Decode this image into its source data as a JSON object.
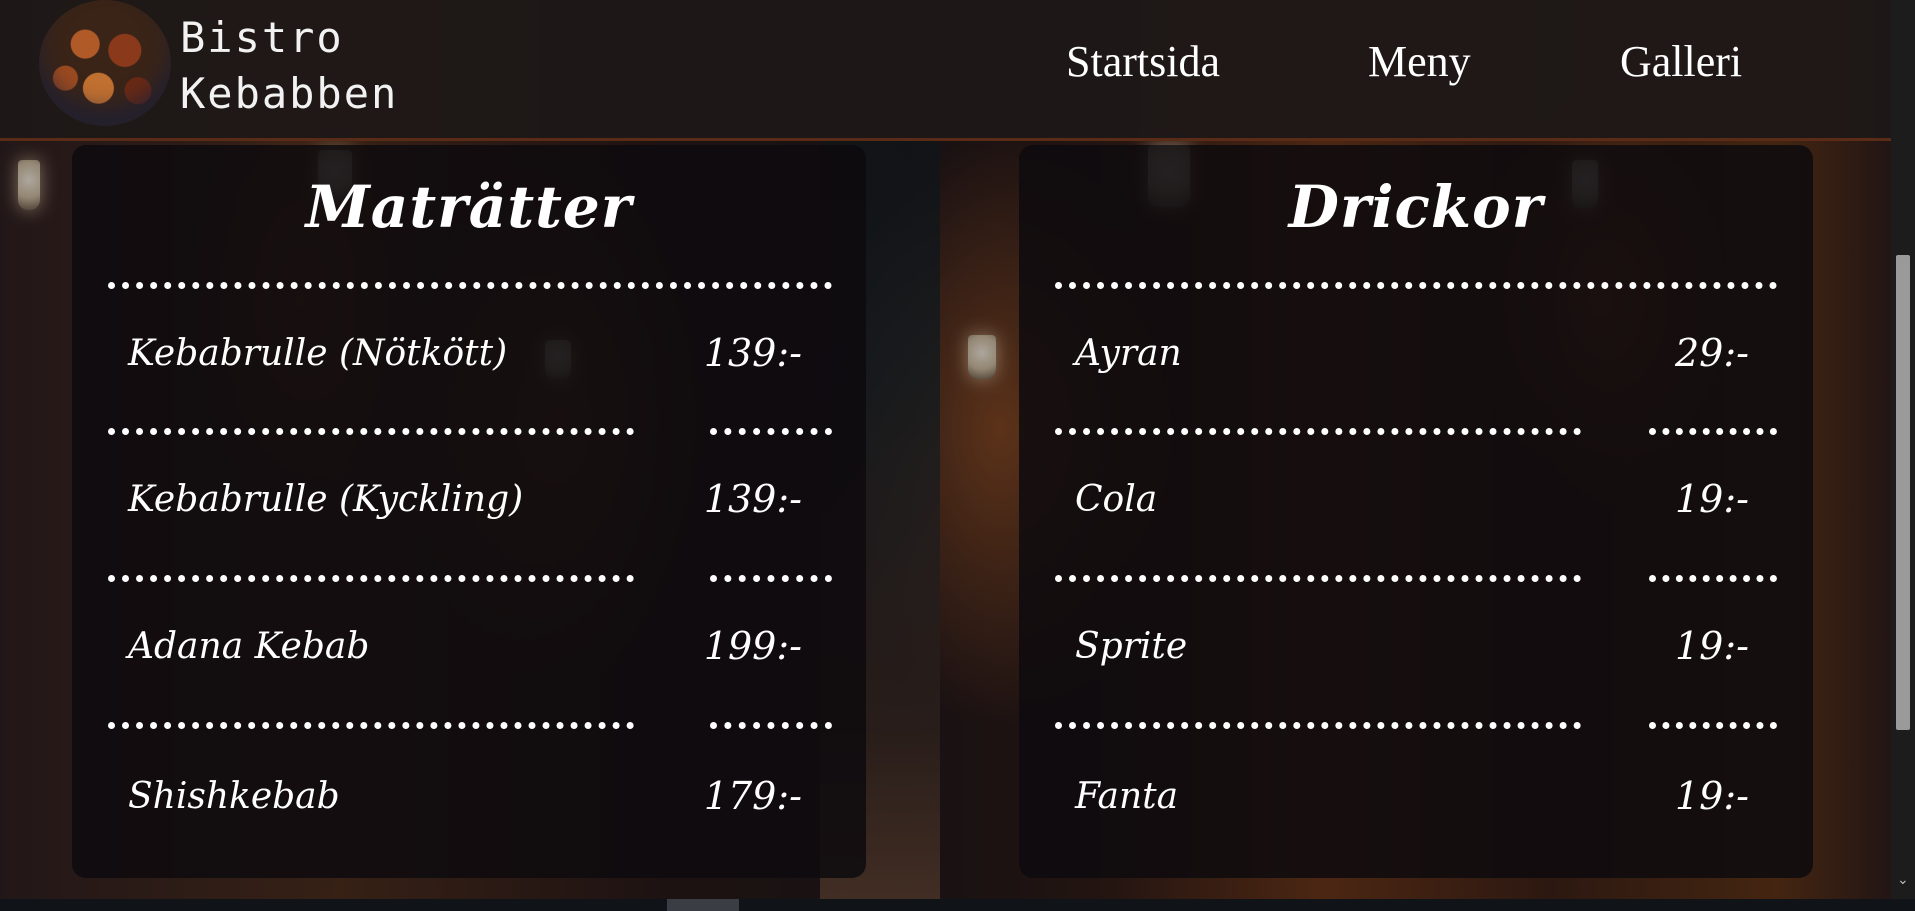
{
  "site": {
    "logo_line1": "Bistro",
    "logo_line2": "Kebabben"
  },
  "nav": {
    "items": [
      "Startsida",
      "Meny",
      "Galleri"
    ]
  },
  "food": {
    "title": "Maträtter",
    "items": [
      {
        "name": "Kebabrulle (Nötkött)",
        "price": "139:-"
      },
      {
        "name": "Kebabrulle (Kyckling)",
        "price": "139:-"
      },
      {
        "name": "Adana Kebab",
        "price": "199:-"
      },
      {
        "name": "Shishkebab",
        "price": "179:-"
      }
    ]
  },
  "drinks": {
    "title": "Drickor",
    "items": [
      {
        "name": "Ayran",
        "price": "29:-"
      },
      {
        "name": "Cola",
        "price": "19:-"
      },
      {
        "name": "Sprite",
        "price": "19:-"
      },
      {
        "name": "Fanta",
        "price": "19:-"
      }
    ]
  },
  "colors": {
    "header_bg": "#1e1818",
    "panel_bg": "#0e0a0e",
    "text": "#ffffff"
  }
}
